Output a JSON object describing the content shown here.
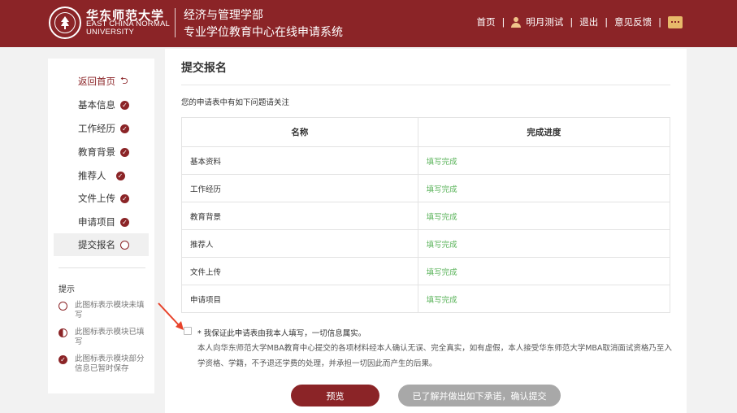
{
  "header": {
    "logo_cn": "华东师范大学",
    "logo_en_line1": "EAST CHINA NORMAL",
    "logo_en_line2": "UNIVERSITY",
    "dept": "经济与管理学部",
    "system_title": "专业学位教育中心在线申请系统",
    "nav": {
      "home": "首页",
      "user": "明月测试",
      "logout": "退出",
      "feedback": "意见反馈"
    }
  },
  "sidebar": {
    "back": "返回首页",
    "items": [
      {
        "label": "基本信息",
        "status": "done"
      },
      {
        "label": "工作经历",
        "status": "done"
      },
      {
        "label": "教育背景",
        "status": "done"
      },
      {
        "label": "推荐人",
        "status": "done"
      },
      {
        "label": "文件上传",
        "status": "done"
      },
      {
        "label": "申请项目",
        "status": "done"
      },
      {
        "label": "提交报名",
        "status": "empty"
      }
    ],
    "tips_title": "提示",
    "tips": [
      "此图标表示模块未填写",
      "此图标表示模块已填写",
      "此图标表示模块部分信息已暂时保存"
    ]
  },
  "main": {
    "title": "提交报名",
    "notice": "您的申请表中有如下问题请关注",
    "table": {
      "headers": [
        "名称",
        "完成进度"
      ],
      "rows": [
        [
          "基本资料",
          "填写完成"
        ],
        [
          "工作经历",
          "填写完成"
        ],
        [
          "教育背景",
          "填写完成"
        ],
        [
          "推荐人",
          "填写完成"
        ],
        [
          "文件上传",
          "填写完成"
        ],
        [
          "申请项目",
          "填写完成"
        ]
      ]
    },
    "pledge": "* 我保证此申请表由我本人填写，一切信息属实。",
    "pledge_detail": "本人向华东师范大学MBA教育中心提交的各项材料经本人确认无误、完全真实，如有虚假，本人接受华东师范大学MBA取消面试资格乃至入学资格、学籍，不予退还学费的处理，并承担一切因此而产生的后果。",
    "preview_button": "预览",
    "submit_button": "已了解并做出如下承诺，确认提交"
  },
  "colors": {
    "brand": "#8b2427",
    "success": "#59b359",
    "disabled_button": "#a8a8a8"
  }
}
